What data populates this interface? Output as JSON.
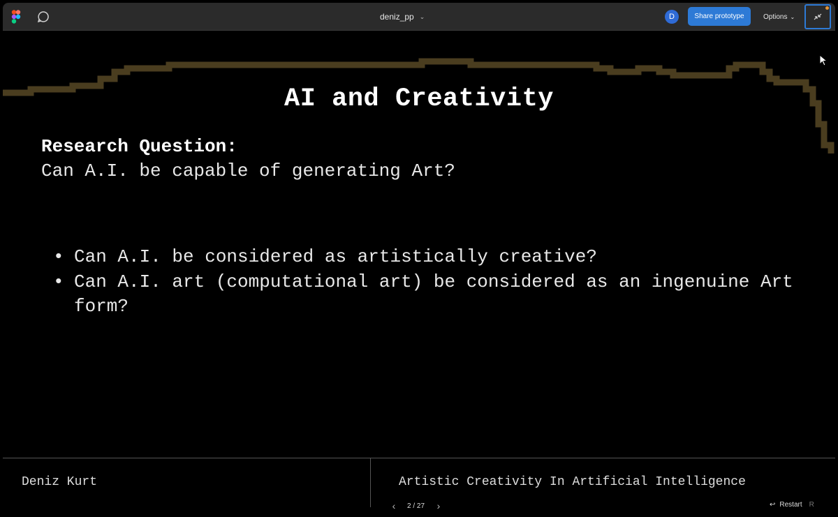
{
  "toolbar": {
    "file_name": "deniz_pp",
    "avatar_initial": "D",
    "share_label": "Share prototype",
    "options_label": "Options"
  },
  "slide": {
    "title": "AI and Creativity",
    "question_label": "Research Question:",
    "question_text": "Can A.I. be capable of generating Art?",
    "bullets": [
      "Can A.I. be considered as artistically creative?",
      "Can A.I. art (computational art) be considered as an ingenuine Art form?"
    ],
    "author": "Deniz Kurt",
    "presentation_title": "Artistic Creativity In Artificial Intelligence"
  },
  "navigation": {
    "page_indicator": "2 / 27",
    "restart_label": "Restart",
    "restart_key": "R"
  },
  "colors": {
    "accent": "#2d7ad6",
    "skyline": "#4a3d1f",
    "toolbar_bg": "#2b2b2b"
  }
}
